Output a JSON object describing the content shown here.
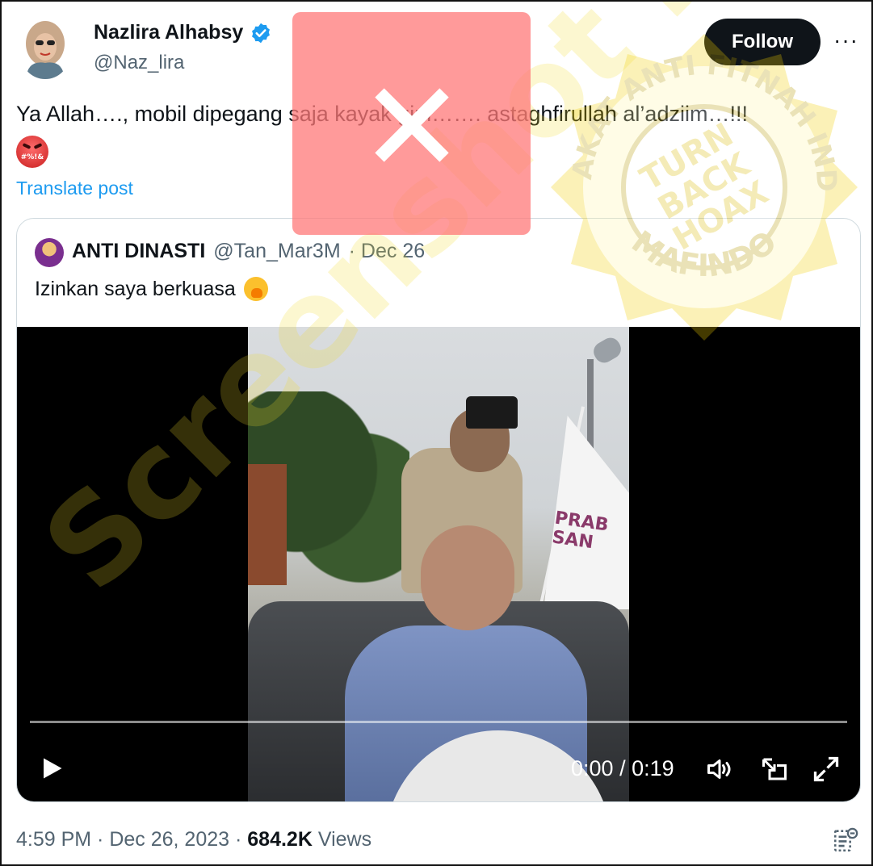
{
  "post": {
    "author": {
      "display_name": "Nazlira Alhabsy",
      "handle": "@Naz_lira",
      "verified": true,
      "avatar_icon": "avatar-hijab-woman-icon"
    },
    "follow_label": "Follow",
    "more_label": "···",
    "text": "Ya Allah…., mobil dipegang saja kayak gini……. astaghfirullah al’adziim…!!!",
    "emoji": "🤬",
    "translate_label": "Translate post",
    "timestamp": "4:59 PM · Dec 26, 2023 ·",
    "views_count": "684.2K",
    "views_label": "Views"
  },
  "quoted_post": {
    "display_name": "ANTI DINASTI",
    "handle": "@Tan_Mar3M",
    "date": "· Dec 26",
    "text": "Izinkan saya berkuasa",
    "emoji": "🤭",
    "video": {
      "current_time": "0:00",
      "separator": "/",
      "duration": "0:19",
      "progress": 0,
      "flag_text_line1": "PRAB",
      "flag_text_line2": "SAN",
      "controls": [
        "play-icon",
        "volume-icon",
        "picture-in-picture-icon",
        "fullscreen-icon"
      ]
    }
  },
  "overlays": {
    "watermark_text": "Screenshot by",
    "seal_text_top": "MASYARAKAT ANTI FITNAH INDONESIA",
    "seal_text_bottom": "MAFINDO",
    "seal_center_line1": "TURN",
    "seal_center_line2": "BACK",
    "seal_center_line3": "HOAX",
    "redaction_icon": "x-mark-icon"
  },
  "colors": {
    "accent": "#1d9bf0",
    "text_primary": "#0f1419",
    "text_secondary": "#536471",
    "follow_bg": "#0f1419",
    "redaction": "#ff7878",
    "watermark": "#f0dc28"
  }
}
